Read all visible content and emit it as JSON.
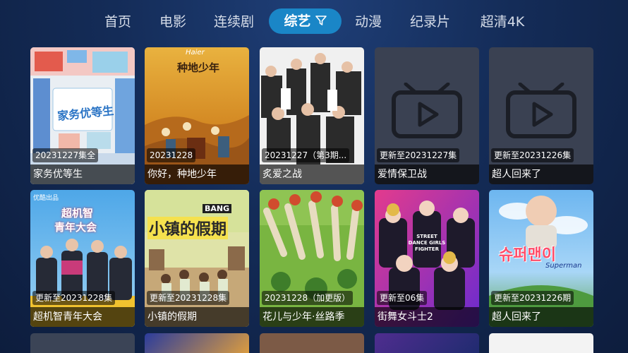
{
  "nav": {
    "tabs": [
      "首页",
      "电影",
      "连续剧",
      "综艺",
      "动漫",
      "纪录片",
      "超清4K"
    ],
    "active_index": 3,
    "filter_icon": "filter-icon"
  },
  "cards": [
    {
      "badge": "20231227集全",
      "title": "家务优等生"
    },
    {
      "badge": "20231228",
      "title": "你好，种地少年"
    },
    {
      "badge": "20231227（第3期...",
      "title": "炙爱之战"
    },
    {
      "badge": "更新至20231227集",
      "title": "爱情保卫战"
    },
    {
      "badge": "更新至20231226集",
      "title": "超人回来了"
    },
    {
      "badge": "更新至20231228集",
      "title": "超机智青年大会"
    },
    {
      "badge": "更新至20231228集",
      "title": "小镇的假期"
    },
    {
      "badge": "20231228（加更版）",
      "title": "花儿与少年·丝路季"
    },
    {
      "badge": "更新至06集",
      "title": "街舞女斗士2"
    },
    {
      "badge": "更新至20231226期",
      "title": "超人回来了"
    }
  ],
  "poster_texts": {
    "c0_logo": "家务优等生",
    "c1_logo": "种地少年",
    "c1_brand": "Haier",
    "c5_logo1": "超机智",
    "c5_logo2": "青年大会",
    "c5_tag": "优酷出品",
    "c6_logo": "小镇的假期",
    "c6_tag": "BANG",
    "c8_tag": "STREET DANCE GIRLS FIGHTER",
    "c9_logo": "슈퍼맨이",
    "c9_sub": "Superman"
  },
  "colors": {
    "accent": "#1a86c7",
    "background": "#142c58",
    "placeholder": "#3a4152"
  }
}
